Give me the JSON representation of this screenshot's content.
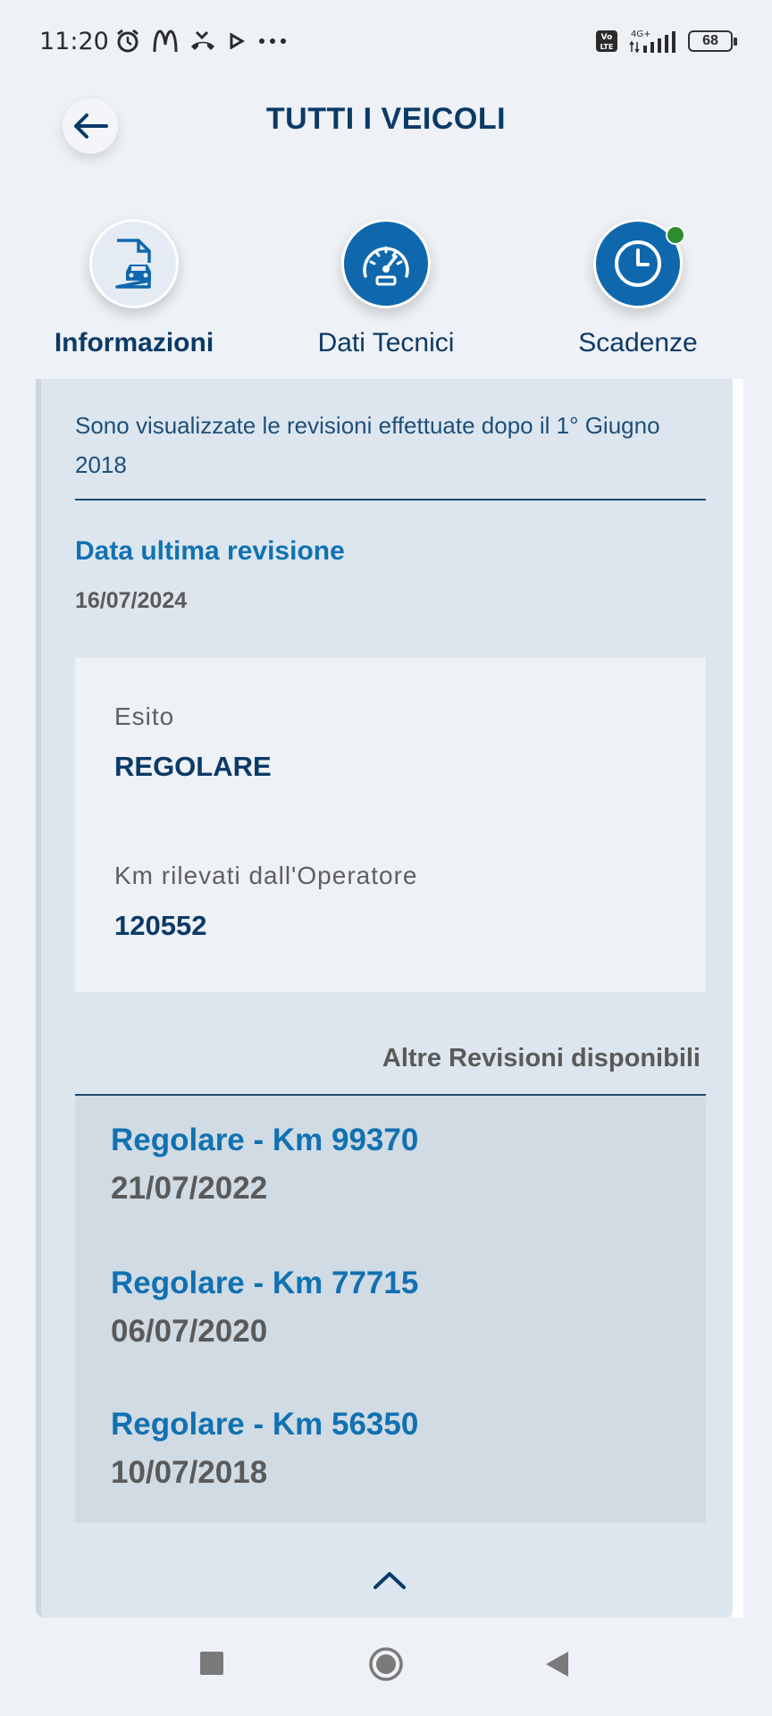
{
  "status_bar": {
    "time": "11:20",
    "battery": "68"
  },
  "header": {
    "title": "TUTTI I VEICOLI"
  },
  "tabs": [
    {
      "label": "Informazioni",
      "icon": "car-document-icon",
      "active": true
    },
    {
      "label": "Dati Tecnici",
      "icon": "speedometer-icon",
      "active": false
    },
    {
      "label": "Scadenze",
      "icon": "clock-icon",
      "active": false,
      "notification": true
    }
  ],
  "main": {
    "info_text": "Sono visualizzate le revisioni effettuate dopo il 1° Giugno 2018",
    "last_revision_label": "Data ultima revisione",
    "last_revision_date": "16/07/2024",
    "esito_label": "Esito",
    "esito_value": "REGOLARE",
    "km_label": "Km rilevati dall'Operatore",
    "km_value": "120552",
    "other_revisions_title": "Altre Revisioni disponibili",
    "other_revisions": [
      {
        "title": "Regolare - Km 99370",
        "date": "21/07/2022"
      },
      {
        "title": "Regolare - Km 77715",
        "date": "06/07/2020"
      },
      {
        "title": "Regolare - Km 56350",
        "date": "10/07/2018"
      }
    ]
  },
  "colors": {
    "primary": "#0b3a66",
    "accent": "#1171b1",
    "tab_fill": "#0f68ad",
    "notification": "#2e8b2e"
  }
}
